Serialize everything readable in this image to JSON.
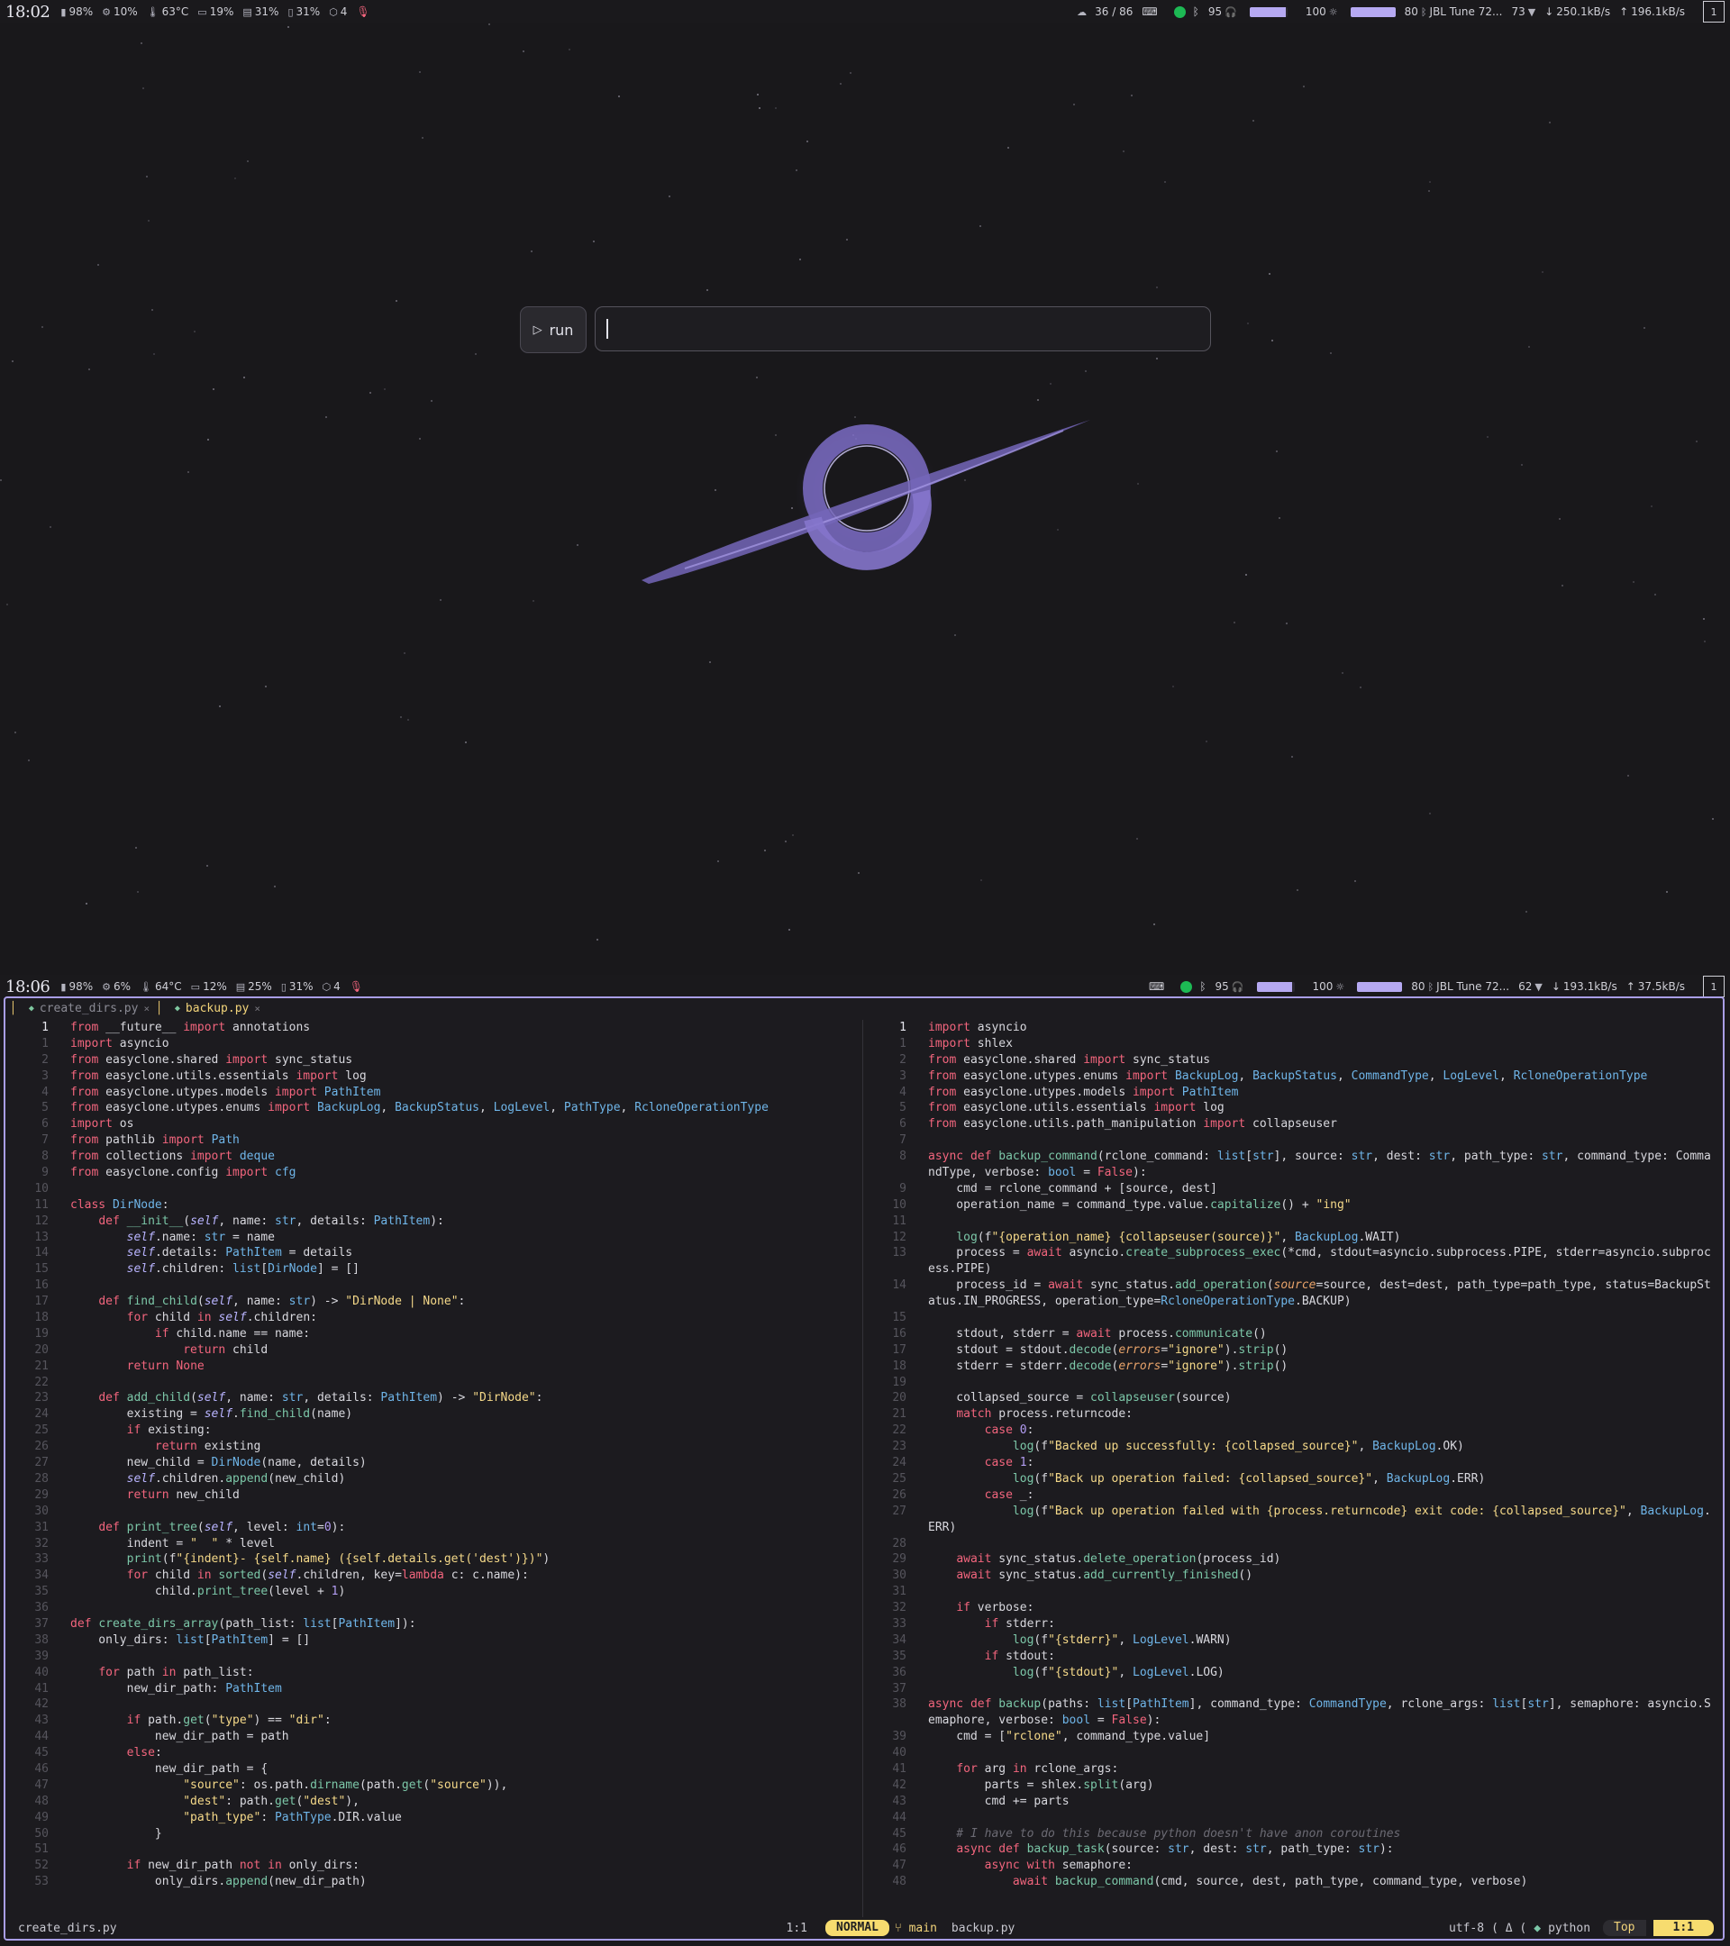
{
  "top_bar": {
    "clock": "18:02",
    "modules": [
      "98%",
      "10%",
      "63°C",
      "19%",
      "31%",
      "31%",
      "4"
    ],
    "workspace_counter": "36 / 86",
    "volume": "95",
    "volume_level": 0.95,
    "brightness": "100",
    "brightness_level": 1.0,
    "bt_battery": "80",
    "bt_device": "JBL Tune 72...",
    "wifi": "73",
    "down": "250.1kB/s",
    "up": "196.1kB/s",
    "workspace": "1"
  },
  "launcher": {
    "run_label": "run",
    "input_value": ""
  },
  "bottom_bar": {
    "clock": "18:06",
    "modules": [
      "98%",
      "6%",
      "64°C",
      "12%",
      "25%",
      "31%",
      "4"
    ],
    "volume": "95",
    "volume_level": 0.95,
    "brightness": "100",
    "brightness_level": 1.0,
    "bt_battery": "80",
    "bt_device": "JBL Tune 72...",
    "wifi": "62",
    "down": "193.1kB/s",
    "up": "37.5kB/s",
    "workspace": "1"
  },
  "tabs": [
    {
      "label": "create_dirs.py",
      "active": false
    },
    {
      "label": "backup.py",
      "active": true
    }
  ],
  "left_file": {
    "current_line": "1",
    "lines": [
      [
        "1",
        "from __future__ import annotations"
      ],
      [
        "1",
        "import asyncio"
      ],
      [
        "2",
        "from easyclone.shared import sync_status"
      ],
      [
        "3",
        "from easyclone.utils.essentials import log"
      ],
      [
        "4",
        "from easyclone.utypes.models import PathItem"
      ],
      [
        "5",
        "from easyclone.utypes.enums import BackupLog, BackupStatus, LogLevel, PathType, RcloneOperationType"
      ],
      [
        "6",
        "import os"
      ],
      [
        "7",
        "from pathlib import Path"
      ],
      [
        "8",
        "from collections import deque"
      ],
      [
        "9",
        "from easyclone.config import cfg"
      ],
      [
        "10",
        ""
      ],
      [
        "11",
        "class DirNode:"
      ],
      [
        "12",
        "    def __init__(self, name: str, details: PathItem):"
      ],
      [
        "13",
        "        self.name: str = name"
      ],
      [
        "14",
        "        self.details: PathItem = details"
      ],
      [
        "15",
        "        self.children: list[DirNode] = []"
      ],
      [
        "16",
        ""
      ],
      [
        "17",
        "    def find_child(self, name: str) -> \"DirNode | None\":"
      ],
      [
        "18",
        "        for child in self.children:"
      ],
      [
        "19",
        "            if child.name == name:"
      ],
      [
        "20",
        "                return child"
      ],
      [
        "21",
        "        return None"
      ],
      [
        "22",
        ""
      ],
      [
        "23",
        "    def add_child(self, name: str, details: PathItem) -> \"DirNode\":"
      ],
      [
        "24",
        "        existing = self.find_child(name)"
      ],
      [
        "25",
        "        if existing:"
      ],
      [
        "26",
        "            return existing"
      ],
      [
        "27",
        "        new_child = DirNode(name, details)"
      ],
      [
        "28",
        "        self.children.append(new_child)"
      ],
      [
        "29",
        "        return new_child"
      ],
      [
        "30",
        ""
      ],
      [
        "31",
        "    def print_tree(self, level: int=0):"
      ],
      [
        "32",
        "        indent = \"  \" * level"
      ],
      [
        "33",
        "        print(f\"{indent}- {self.name} ({self.details.get('dest')})\")"
      ],
      [
        "34",
        "        for child in sorted(self.children, key=lambda c: c.name):"
      ],
      [
        "35",
        "            child.print_tree(level + 1)"
      ],
      [
        "36",
        ""
      ],
      [
        "37",
        "def create_dirs_array(path_list: list[PathItem]):"
      ],
      [
        "38",
        "    only_dirs: list[PathItem] = []"
      ],
      [
        "39",
        ""
      ],
      [
        "40",
        "    for path in path_list:"
      ],
      [
        "41",
        "        new_dir_path: PathItem"
      ],
      [
        "42",
        ""
      ],
      [
        "43",
        "        if path.get(\"type\") == \"dir\":"
      ],
      [
        "44",
        "            new_dir_path = path"
      ],
      [
        "45",
        "        else:"
      ],
      [
        "46",
        "            new_dir_path = {"
      ],
      [
        "47",
        "                \"source\": os.path.dirname(path.get(\"source\")),"
      ],
      [
        "48",
        "                \"dest\": path.get(\"dest\"),"
      ],
      [
        "49",
        "                \"path_type\": PathType.DIR.value"
      ],
      [
        "50",
        "            }"
      ],
      [
        "51",
        ""
      ],
      [
        "52",
        "        if new_dir_path not in only_dirs:"
      ],
      [
        "53",
        "            only_dirs.append(new_dir_path)"
      ]
    ]
  },
  "right_file": {
    "current_line": "1",
    "lines": [
      [
        "1",
        "import asyncio"
      ],
      [
        "1",
        "import shlex"
      ],
      [
        "2",
        "from easyclone.shared import sync_status"
      ],
      [
        "3",
        "from easyclone.utypes.enums import BackupLog, BackupStatus, CommandType, LogLevel, RcloneOperationType"
      ],
      [
        "4",
        "from easyclone.utypes.models import PathItem"
      ],
      [
        "5",
        "from easyclone.utils.essentials import log"
      ],
      [
        "6",
        "from easyclone.utils.path_manipulation import collapseuser"
      ],
      [
        "7",
        ""
      ],
      [
        "8",
        "async def backup_command(rclone_command: list[str], source: str, dest: str, path_type: str, command_type: Comma"
      ],
      [
        "",
        "ndType, verbose: bool = False):"
      ],
      [
        "9",
        "    cmd = rclone_command + [source, dest]"
      ],
      [
        "10",
        "    operation_name = command_type.value.capitalize() + \"ing\""
      ],
      [
        "11",
        ""
      ],
      [
        "12",
        "    log(f\"{operation_name} {collapseuser(source)}\", BackupLog.WAIT)"
      ],
      [
        "13",
        "    process = await asyncio.create_subprocess_exec(*cmd, stdout=asyncio.subprocess.PIPE, stderr=asyncio.subproc"
      ],
      [
        "",
        "ess.PIPE)"
      ],
      [
        "14",
        "    process_id = await sync_status.add_operation(source=source, dest=dest, path_type=path_type, status=BackupSt"
      ],
      [
        "",
        "atus.IN_PROGRESS, operation_type=RcloneOperationType.BACKUP)"
      ],
      [
        "15",
        ""
      ],
      [
        "16",
        "    stdout, stderr = await process.communicate()"
      ],
      [
        "17",
        "    stdout = stdout.decode(errors=\"ignore\").strip()"
      ],
      [
        "18",
        "    stderr = stderr.decode(errors=\"ignore\").strip()"
      ],
      [
        "19",
        ""
      ],
      [
        "20",
        "    collapsed_source = collapseuser(source)"
      ],
      [
        "21",
        "    match process.returncode:"
      ],
      [
        "22",
        "        case 0:"
      ],
      [
        "23",
        "            log(f\"Backed up successfully: {collapsed_source}\", BackupLog.OK)"
      ],
      [
        "24",
        "        case 1:"
      ],
      [
        "25",
        "            log(f\"Back up operation failed: {collapsed_source}\", BackupLog.ERR)"
      ],
      [
        "26",
        "        case _:"
      ],
      [
        "27",
        "            log(f\"Back up operation failed with {process.returncode} exit code: {collapsed_source}\", BackupLog."
      ],
      [
        "",
        "ERR)"
      ],
      [
        "28",
        ""
      ],
      [
        "29",
        "    await sync_status.delete_operation(process_id)"
      ],
      [
        "30",
        "    await sync_status.add_currently_finished()"
      ],
      [
        "31",
        ""
      ],
      [
        "32",
        "    if verbose:"
      ],
      [
        "33",
        "        if stderr:"
      ],
      [
        "34",
        "            log(f\"{stderr}\", LogLevel.WARN)"
      ],
      [
        "35",
        "        if stdout:"
      ],
      [
        "36",
        "            log(f\"{stdout}\", LogLevel.LOG)"
      ],
      [
        "37",
        ""
      ],
      [
        "38",
        "async def backup(paths: list[PathItem], command_type: CommandType, rclone_args: list[str], semaphore: asyncio.S"
      ],
      [
        "",
        "emaphore, verbose: bool = False):"
      ],
      [
        "39",
        "    cmd = [\"rclone\", command_type.value]"
      ],
      [
        "40",
        ""
      ],
      [
        "41",
        "    for arg in rclone_args:"
      ],
      [
        "42",
        "        parts = shlex.split(arg)"
      ],
      [
        "43",
        "        cmd += parts"
      ],
      [
        "44",
        ""
      ],
      [
        "45",
        "    # I have to do this because python doesn't have anon coroutines"
      ],
      [
        "46",
        "    async def backup_task(source: str, dest: str, path_type: str):"
      ],
      [
        "47",
        "        async with semaphore:"
      ],
      [
        "48",
        "            await backup_command(cmd, source, dest, path_type, command_type, verbose)"
      ]
    ]
  },
  "statusline": {
    "left_file": "create_dirs.py",
    "left_pos": "1:1",
    "mode": "NORMAL",
    "branch": "main",
    "right_file": "backup.py",
    "encoding": "utf-8",
    "filetype": "python",
    "scroll": "Top",
    "pos": "1:1"
  },
  "colors": {
    "accent": "#b6a9f2",
    "mode_bg": "#f7dc6f",
    "keyword": "#f2657d",
    "function": "#7cc7a8",
    "type": "#6fb5e8",
    "string": "#f5d989"
  }
}
